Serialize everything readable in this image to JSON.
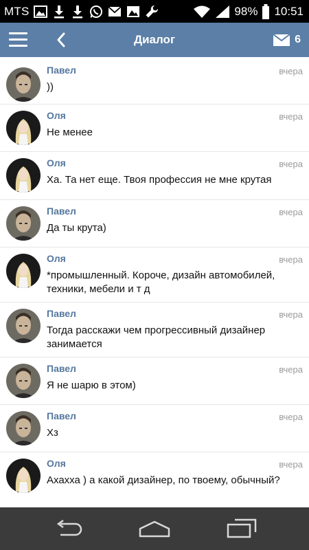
{
  "status_bar": {
    "carrier": "MTS",
    "battery": "98%",
    "time": "10:51",
    "left_icons": [
      "image-icon",
      "download-icon",
      "download-icon",
      "whatsapp-icon",
      "mail-icon",
      "gallery-icon",
      "wrench-icon"
    ],
    "right_icons": [
      "wifi-icon",
      "signal-icon",
      "battery-icon"
    ]
  },
  "header": {
    "title": "Диалог",
    "mail_count": "6",
    "color": "#5b7fa7"
  },
  "messages": [
    {
      "author": "Павел",
      "time": "вчера",
      "text": "))",
      "avatar": "pavel"
    },
    {
      "author": "Оля",
      "time": "вчера",
      "text": "Не менее",
      "avatar": "olya"
    },
    {
      "author": "Оля",
      "time": "вчера",
      "text": "Ха. Та нет еще. Твоя профессия не мне крутая",
      "avatar": "olya"
    },
    {
      "author": "Павел",
      "time": "вчера",
      "text": "Да ты крута)",
      "avatar": "pavel"
    },
    {
      "author": "Оля",
      "time": "вчера",
      "text": "*промышленный. Короче, дизайн автомобилей, техники, мебели и т д",
      "avatar": "olya"
    },
    {
      "author": "Павел",
      "time": "вчера",
      "text": "Тогда расскажи чем прогрессивный дизайнер занимается",
      "avatar": "pavel"
    },
    {
      "author": "Павел",
      "time": "вчера",
      "text": "Я не шарю в этом)",
      "avatar": "pavel"
    },
    {
      "author": "Павел",
      "time": "вчера",
      "text": "Хз",
      "avatar": "pavel"
    },
    {
      "author": "Оля",
      "time": "вчера",
      "text": "Ахахха ) а какой дизайнер, по твоему, обычный?",
      "avatar": "olya"
    }
  ],
  "navbar": {
    "buttons": [
      "back-icon",
      "home-icon",
      "recent-apps-icon"
    ]
  }
}
